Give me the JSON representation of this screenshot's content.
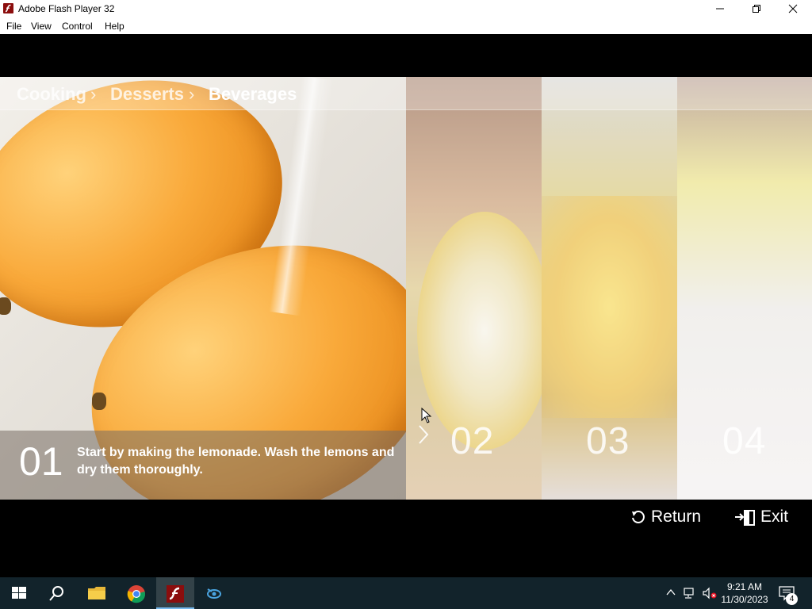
{
  "window": {
    "title": "Adobe Flash Player 32",
    "app_icon": "flash-player-icon",
    "controls": [
      "minimize-icon",
      "maximize-icon",
      "close-icon"
    ]
  },
  "menubar": {
    "items": [
      {
        "label": "File"
      },
      {
        "label": "View"
      },
      {
        "label": "Control"
      },
      {
        "label": "Help"
      }
    ]
  },
  "breadcrumb": {
    "items": [
      "Cooking",
      "Desserts",
      "Beverages"
    ],
    "separator": "›",
    "active_index": 2
  },
  "slides": {
    "current": {
      "number": "01",
      "text": "Start by making the lemonade. Wash the lemons and dry them thoroughly."
    },
    "upcoming": [
      "02",
      "03",
      "04"
    ]
  },
  "controls": {
    "return_label": "Return",
    "exit_label": "Exit"
  },
  "taskbar": {
    "pinned": [
      "windows-start-icon",
      "search-icon",
      "file-explorer-icon",
      "chrome-icon",
      "flash-player-icon",
      "app-icon"
    ],
    "active": "flash-player-icon",
    "tray": {
      "time": "9:21 AM",
      "date": "11/30/2023",
      "notifications": "4"
    }
  },
  "colors": {
    "taskbar": "#12232b",
    "stage": "#000000",
    "flash_red": "#8b0d0d"
  }
}
